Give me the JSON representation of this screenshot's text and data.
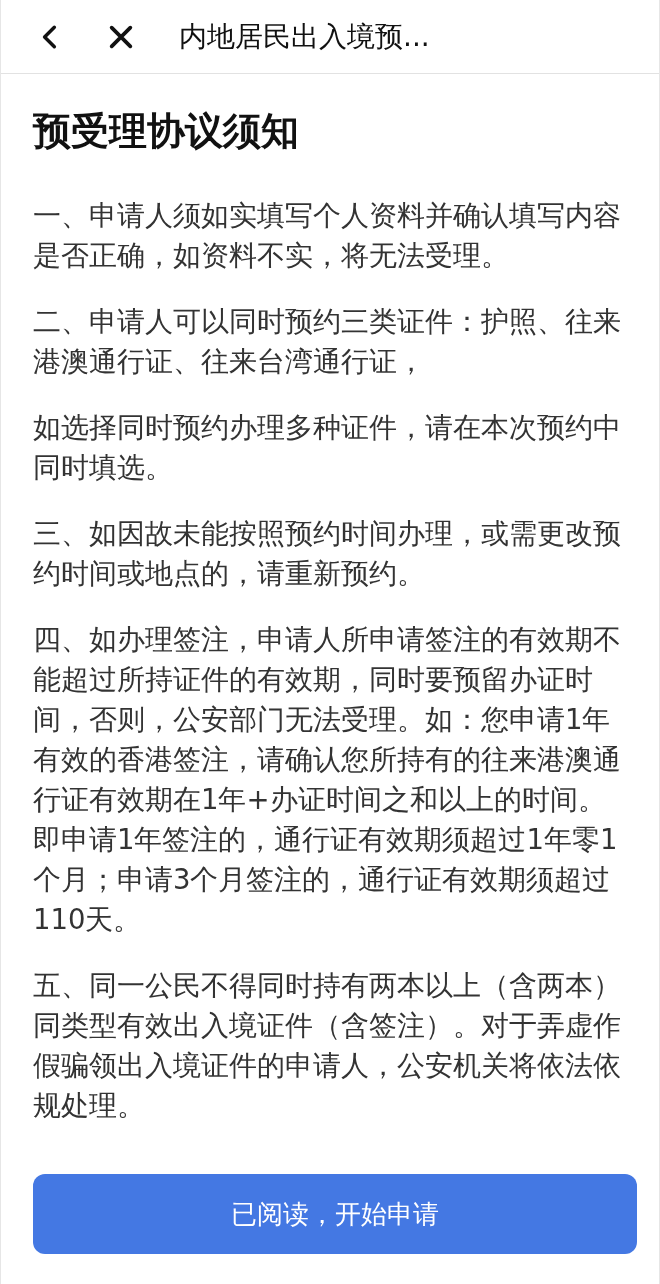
{
  "header": {
    "title": "内地居民出入境预..."
  },
  "heading": "预受理协议须知",
  "paragraphs": [
    "一、申请人须如实填写个人资料并确认填写内容是否正确，如资料不实，将无法受理。",
    "二、申请人可以同时预约三类证件：护照、往来港澳通行证、往来台湾通行证，",
    "如选择同时预约办理多种证件，请在本次预约中同时填选。",
    "三、如因故未能按照预约时间办理，或需更改预约时间或地点的，请重新预约。",
    "四、如办理签注，申请人所申请签注的有效期不能超过所持证件的有效期，同时要预留办证时间，否则，公安部门无法受理。如：您申请1年有效的香港签注，请确认您所持有的往来港澳通行证有效期在1年+办证时间之和以上的时间。即申请1年签注的，通行证有效期须超过1年零1个月；申请3个月签注的，通行证有效期须超过110天。",
    "五、同一公民不得同时持有两本以上（含两本）同类型有效出入境证件（含签注）。对于弄虚作假骗领出入境证件的申请人，公安机关将依法依规处理。"
  ],
  "button": "已阅读，开始申请"
}
